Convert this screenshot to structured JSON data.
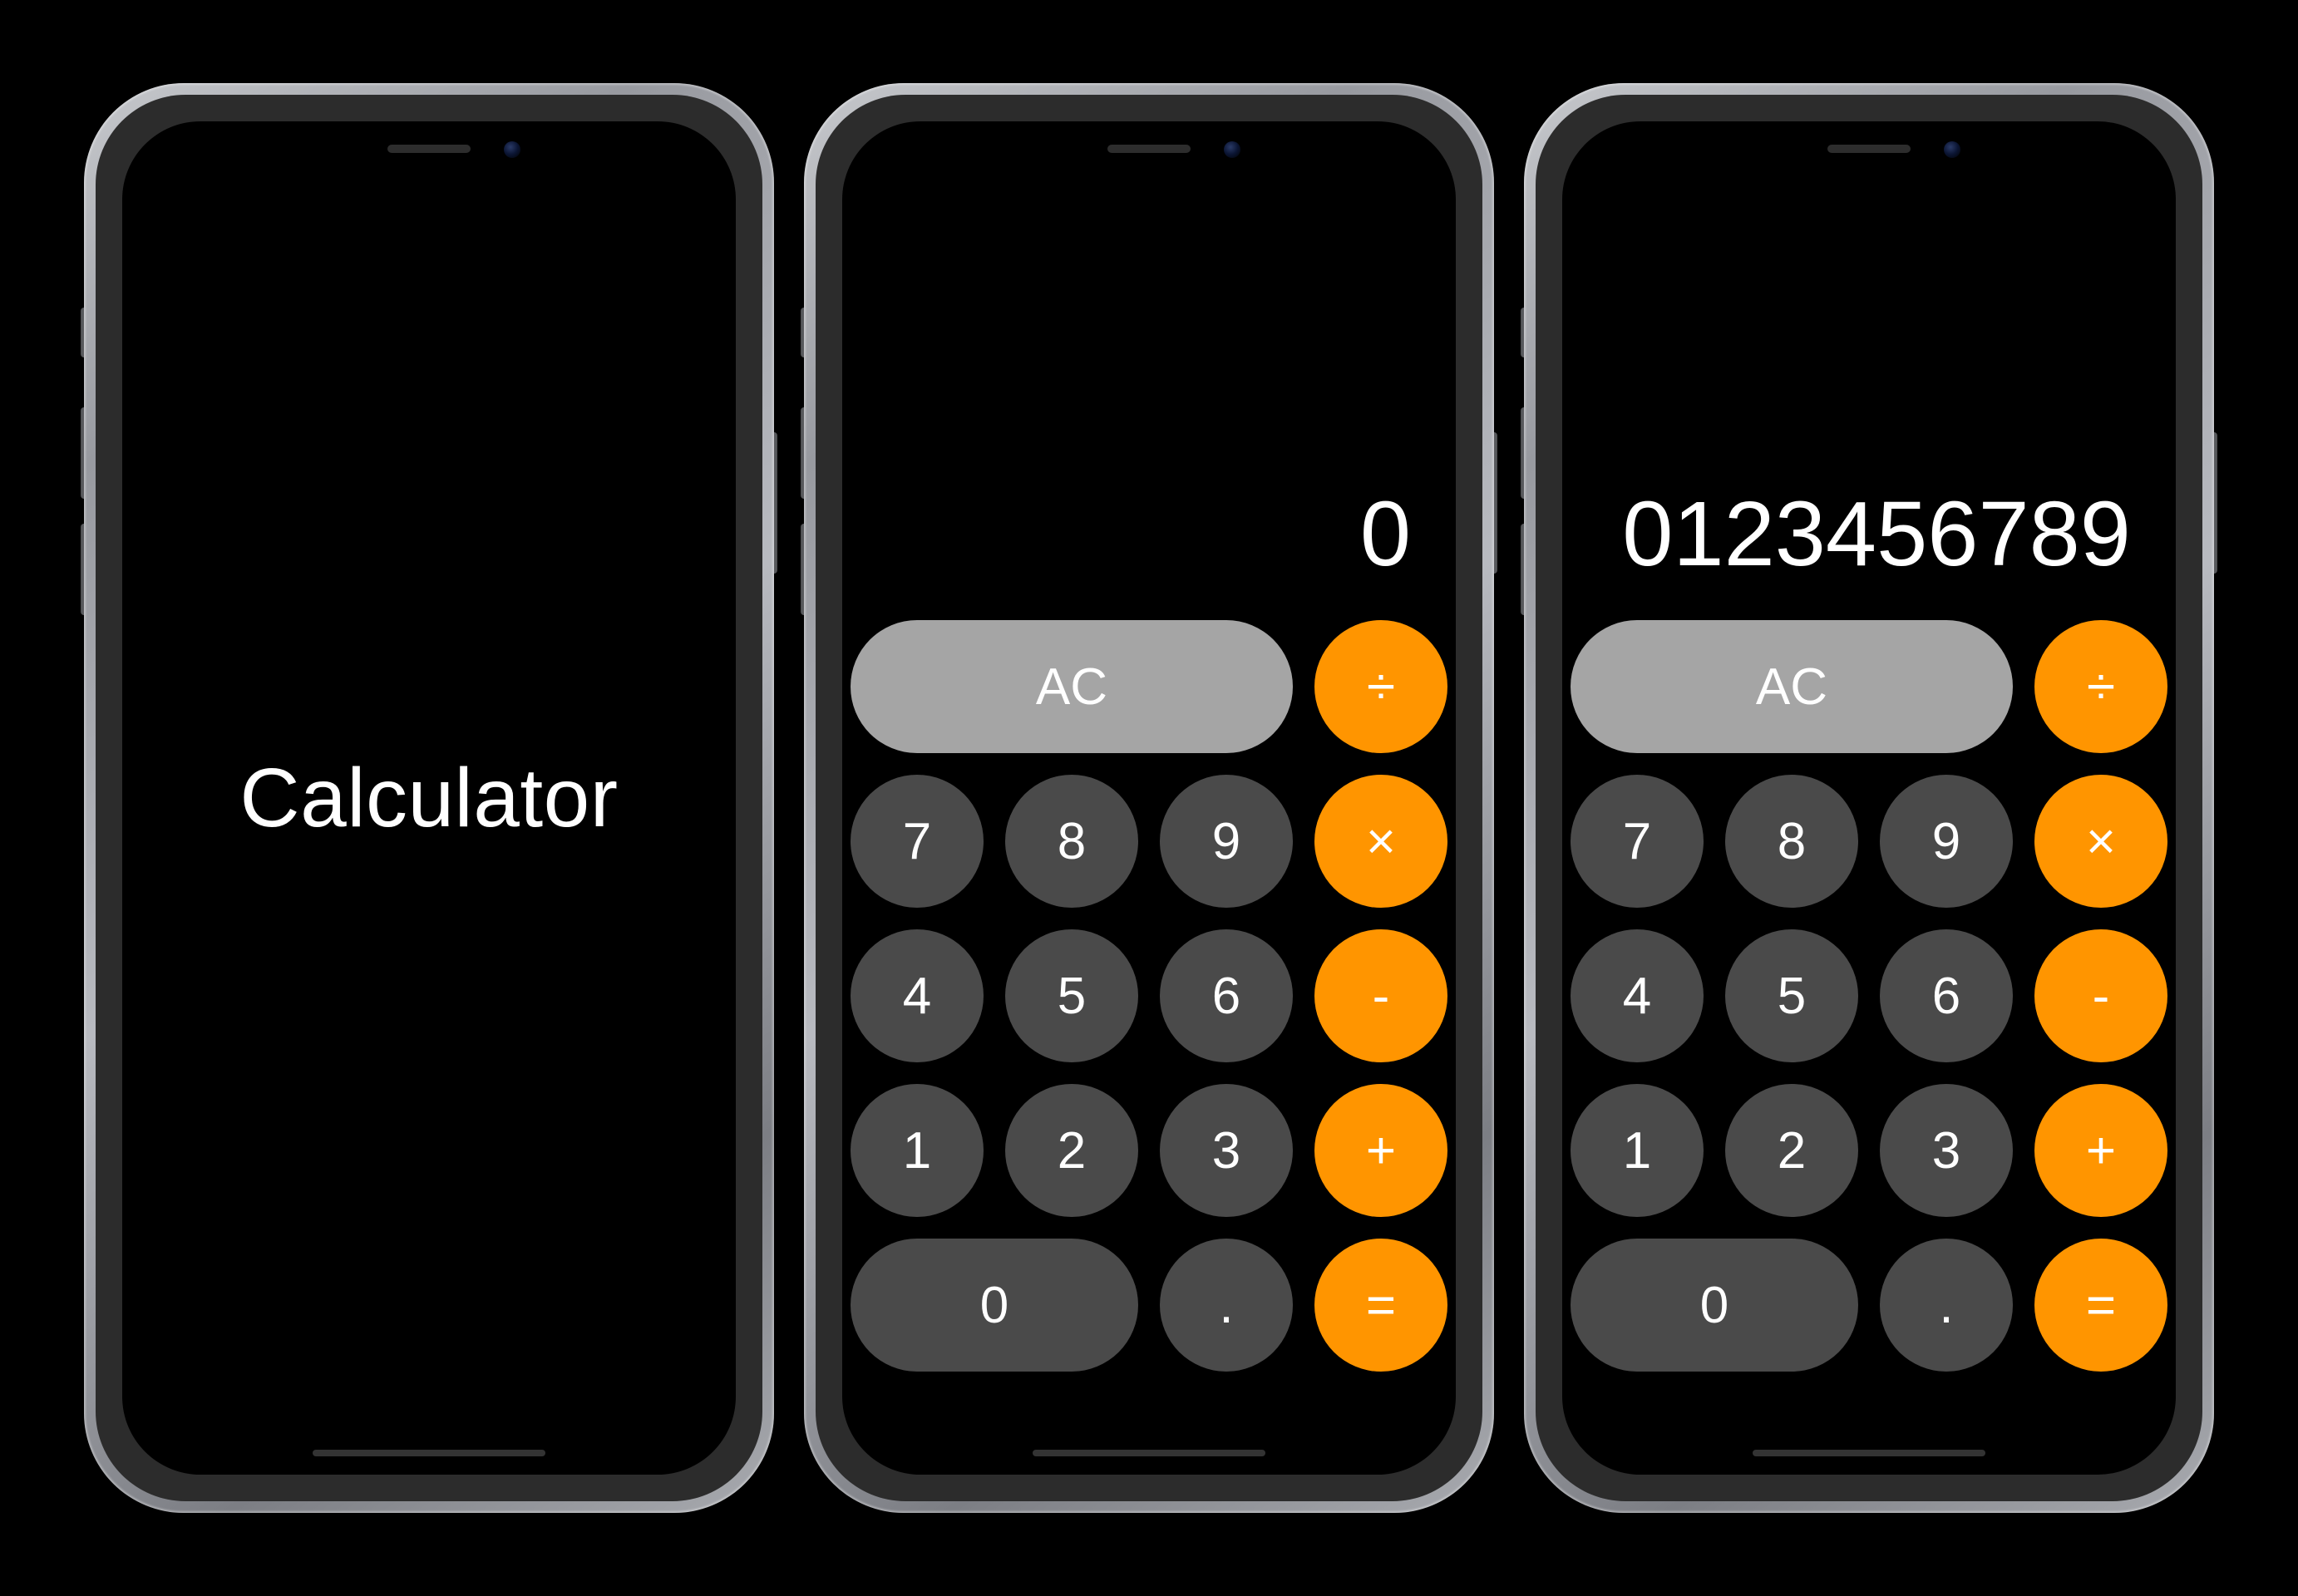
{
  "splash": {
    "title": "Calculator"
  },
  "calc_a": {
    "display": "0",
    "ac": "AC",
    "divide": "÷",
    "multiply": "×",
    "minus": "-",
    "plus": "+",
    "equals": "=",
    "decimal": ".",
    "n0": "0",
    "n1": "1",
    "n2": "2",
    "n3": "3",
    "n4": "4",
    "n5": "5",
    "n6": "6",
    "n7": "7",
    "n8": "8",
    "n9": "9"
  },
  "calc_b": {
    "display": "0123456789",
    "ac": "AC",
    "divide": "÷",
    "multiply": "×",
    "minus": "-",
    "plus": "+",
    "equals": "=",
    "decimal": ".",
    "n0": "0",
    "n1": "1",
    "n2": "2",
    "n3": "3",
    "n4": "4",
    "n5": "5",
    "n6": "6",
    "n7": "7",
    "n8": "8",
    "n9": "9"
  },
  "colors": {
    "operator": "#ff9500",
    "number": "#4a4a4a",
    "function": "#a5a5a5",
    "background": "#000000"
  }
}
